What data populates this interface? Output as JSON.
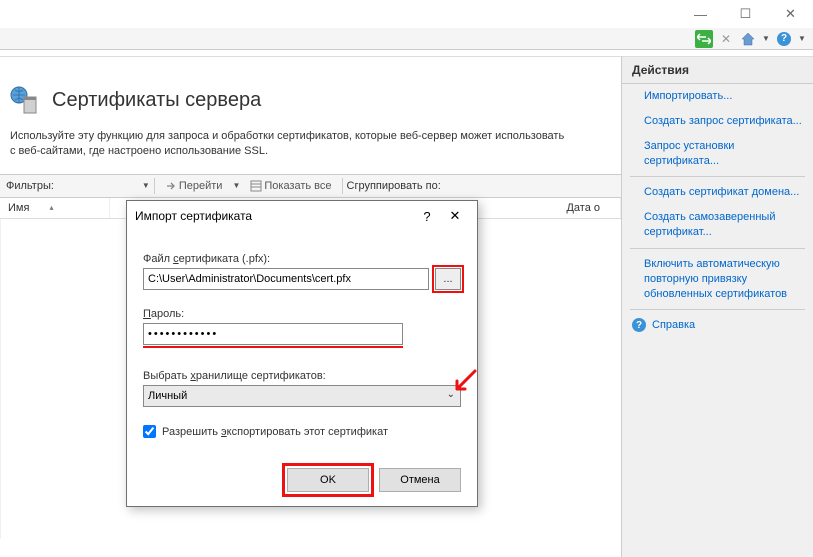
{
  "window": {
    "min": "—",
    "max": "☐",
    "close": "✕"
  },
  "toolbar_icons": {
    "refresh": "⟳↔",
    "stop": "✕",
    "home": "home",
    "help": "?"
  },
  "page": {
    "title": "Сертификаты сервера",
    "desc": "Используйте эту функцию для запроса и обработки сертификатов, которые веб-сервер может использовать с веб-сайтами, где настроено использование SSL."
  },
  "filter": {
    "label": "Фильтры:",
    "go": "Перейти",
    "show_all": "Показать все",
    "group": "Сгруппировать по:"
  },
  "columns": {
    "name": "Имя",
    "date": "Дата о"
  },
  "actions": {
    "title": "Действия",
    "import": "Импортировать...",
    "create_req": "Создать запрос сертификата...",
    "install_req": "Запрос установки сертификата...",
    "domain_cert": "Создать сертификат домена...",
    "self_signed": "Создать самозаверенный сертификат...",
    "auto_rebind": "Включить автоматическую повторную привязку обновленных сертификатов",
    "help": "Справка"
  },
  "dialog": {
    "title": "Импорт сертификата",
    "file_label_pre": "Файл ",
    "file_label_u": "с",
    "file_label_post": "ертификата (.pfx):",
    "file_value": "C:\\User\\Administrator\\Documents\\cert.pfx",
    "browse": "...",
    "pw_label_u": "П",
    "pw_label_post": "ароль:",
    "pw_value": "••••••••••••",
    "store_label_pre": "Выбрать ",
    "store_label_u": "х",
    "store_label_post": "ранилище сертификатов:",
    "store_value": "Личный",
    "allow_export_pre": "Разрешить ",
    "allow_export_u": "э",
    "allow_export_post": "кспортировать этот сертификат",
    "ok": "OK",
    "cancel": "Отмена"
  }
}
